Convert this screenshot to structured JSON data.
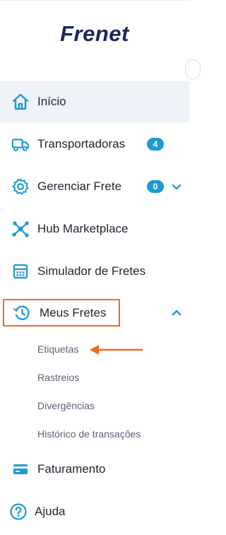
{
  "brand": {
    "logo_text": "Frenet"
  },
  "nav": {
    "inicio": {
      "label": "Início",
      "icon": "home-icon"
    },
    "transportadoras": {
      "label": "Transportadoras",
      "icon": "truck-icon",
      "badge": "4"
    },
    "gerenciar": {
      "label": "Gerenciar Frete",
      "icon": "gear-icon",
      "badge": "0"
    },
    "hub": {
      "label": "Hub Marketplace",
      "icon": "hub-network-icon"
    },
    "simulador": {
      "label": "Simulador de Fretes",
      "icon": "calculator-icon"
    },
    "meus_fretes": {
      "label": "Meus Fretes",
      "icon": "history-icon",
      "expanded": true,
      "sub_items": [
        {
          "label": "Etiquetas"
        },
        {
          "label": "Rastreios"
        },
        {
          "label": "Divergências"
        },
        {
          "label": "Histórico de transações"
        }
      ]
    },
    "faturamento": {
      "label": "Faturamento",
      "icon": "credit-card-icon"
    },
    "ajuda": {
      "label": "Ajuda",
      "icon": "help-circle-icon"
    }
  },
  "colors": {
    "accent": "#1b9ad6",
    "brand_text": "#1b2761",
    "highlight": "#f26a21",
    "active_bg": "#eef2f9"
  }
}
